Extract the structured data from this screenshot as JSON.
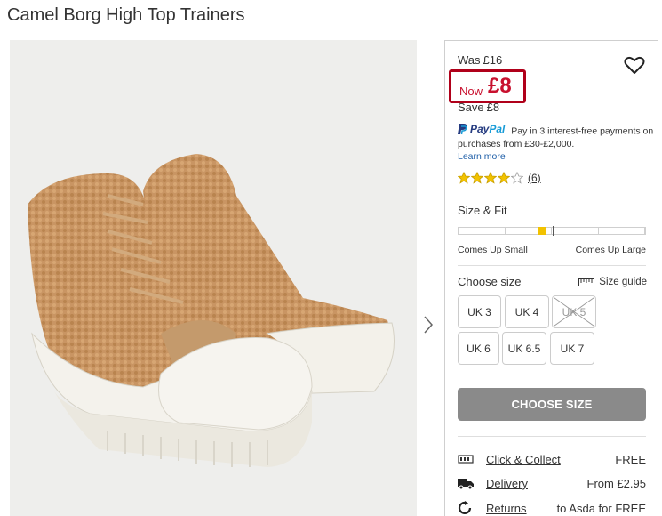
{
  "product": {
    "title": "Camel Borg High Top Trainers"
  },
  "pricing": {
    "was_label": "Was",
    "was_price": "£16",
    "now_label": "Now",
    "now_price": "£8",
    "save_label": "Save",
    "save_amount": "£8"
  },
  "paypal": {
    "logo_part1": "Pay",
    "logo_part2": "Pal",
    "message": "Pay in 3 interest-free payments on purchases from £30-£2,000.",
    "learn_more": "Learn more"
  },
  "reviews": {
    "rating": 4,
    "max": 5,
    "count": "(6)"
  },
  "size_fit": {
    "title": "Size & Fit",
    "left_label": "Comes Up Small",
    "right_label": "Comes Up Large",
    "fit_value": 0.42
  },
  "sizes": {
    "title": "Choose size",
    "size_guide": "Size guide",
    "options": [
      {
        "label": "UK 3",
        "available": true
      },
      {
        "label": "UK 4",
        "available": true
      },
      {
        "label": "UK 5",
        "available": false
      },
      {
        "label": "UK 6",
        "available": true
      },
      {
        "label": "UK 6.5",
        "available": true
      },
      {
        "label": "UK 7",
        "available": true
      }
    ]
  },
  "cta": {
    "label": "CHOOSE SIZE"
  },
  "delivery": [
    {
      "icon": "store-icon",
      "label": "Click & Collect",
      "value": "FREE"
    },
    {
      "icon": "truck-icon",
      "label": "Delivery",
      "value": "From £2.95"
    },
    {
      "icon": "returns-icon",
      "label": "Returns",
      "value": "to Asda for FREE"
    }
  ],
  "colors": {
    "sale_red": "#c8102e",
    "star_gold": "#f2c200",
    "button_grey": "#8a8a8a",
    "link_blue": "#1f5fa8"
  }
}
